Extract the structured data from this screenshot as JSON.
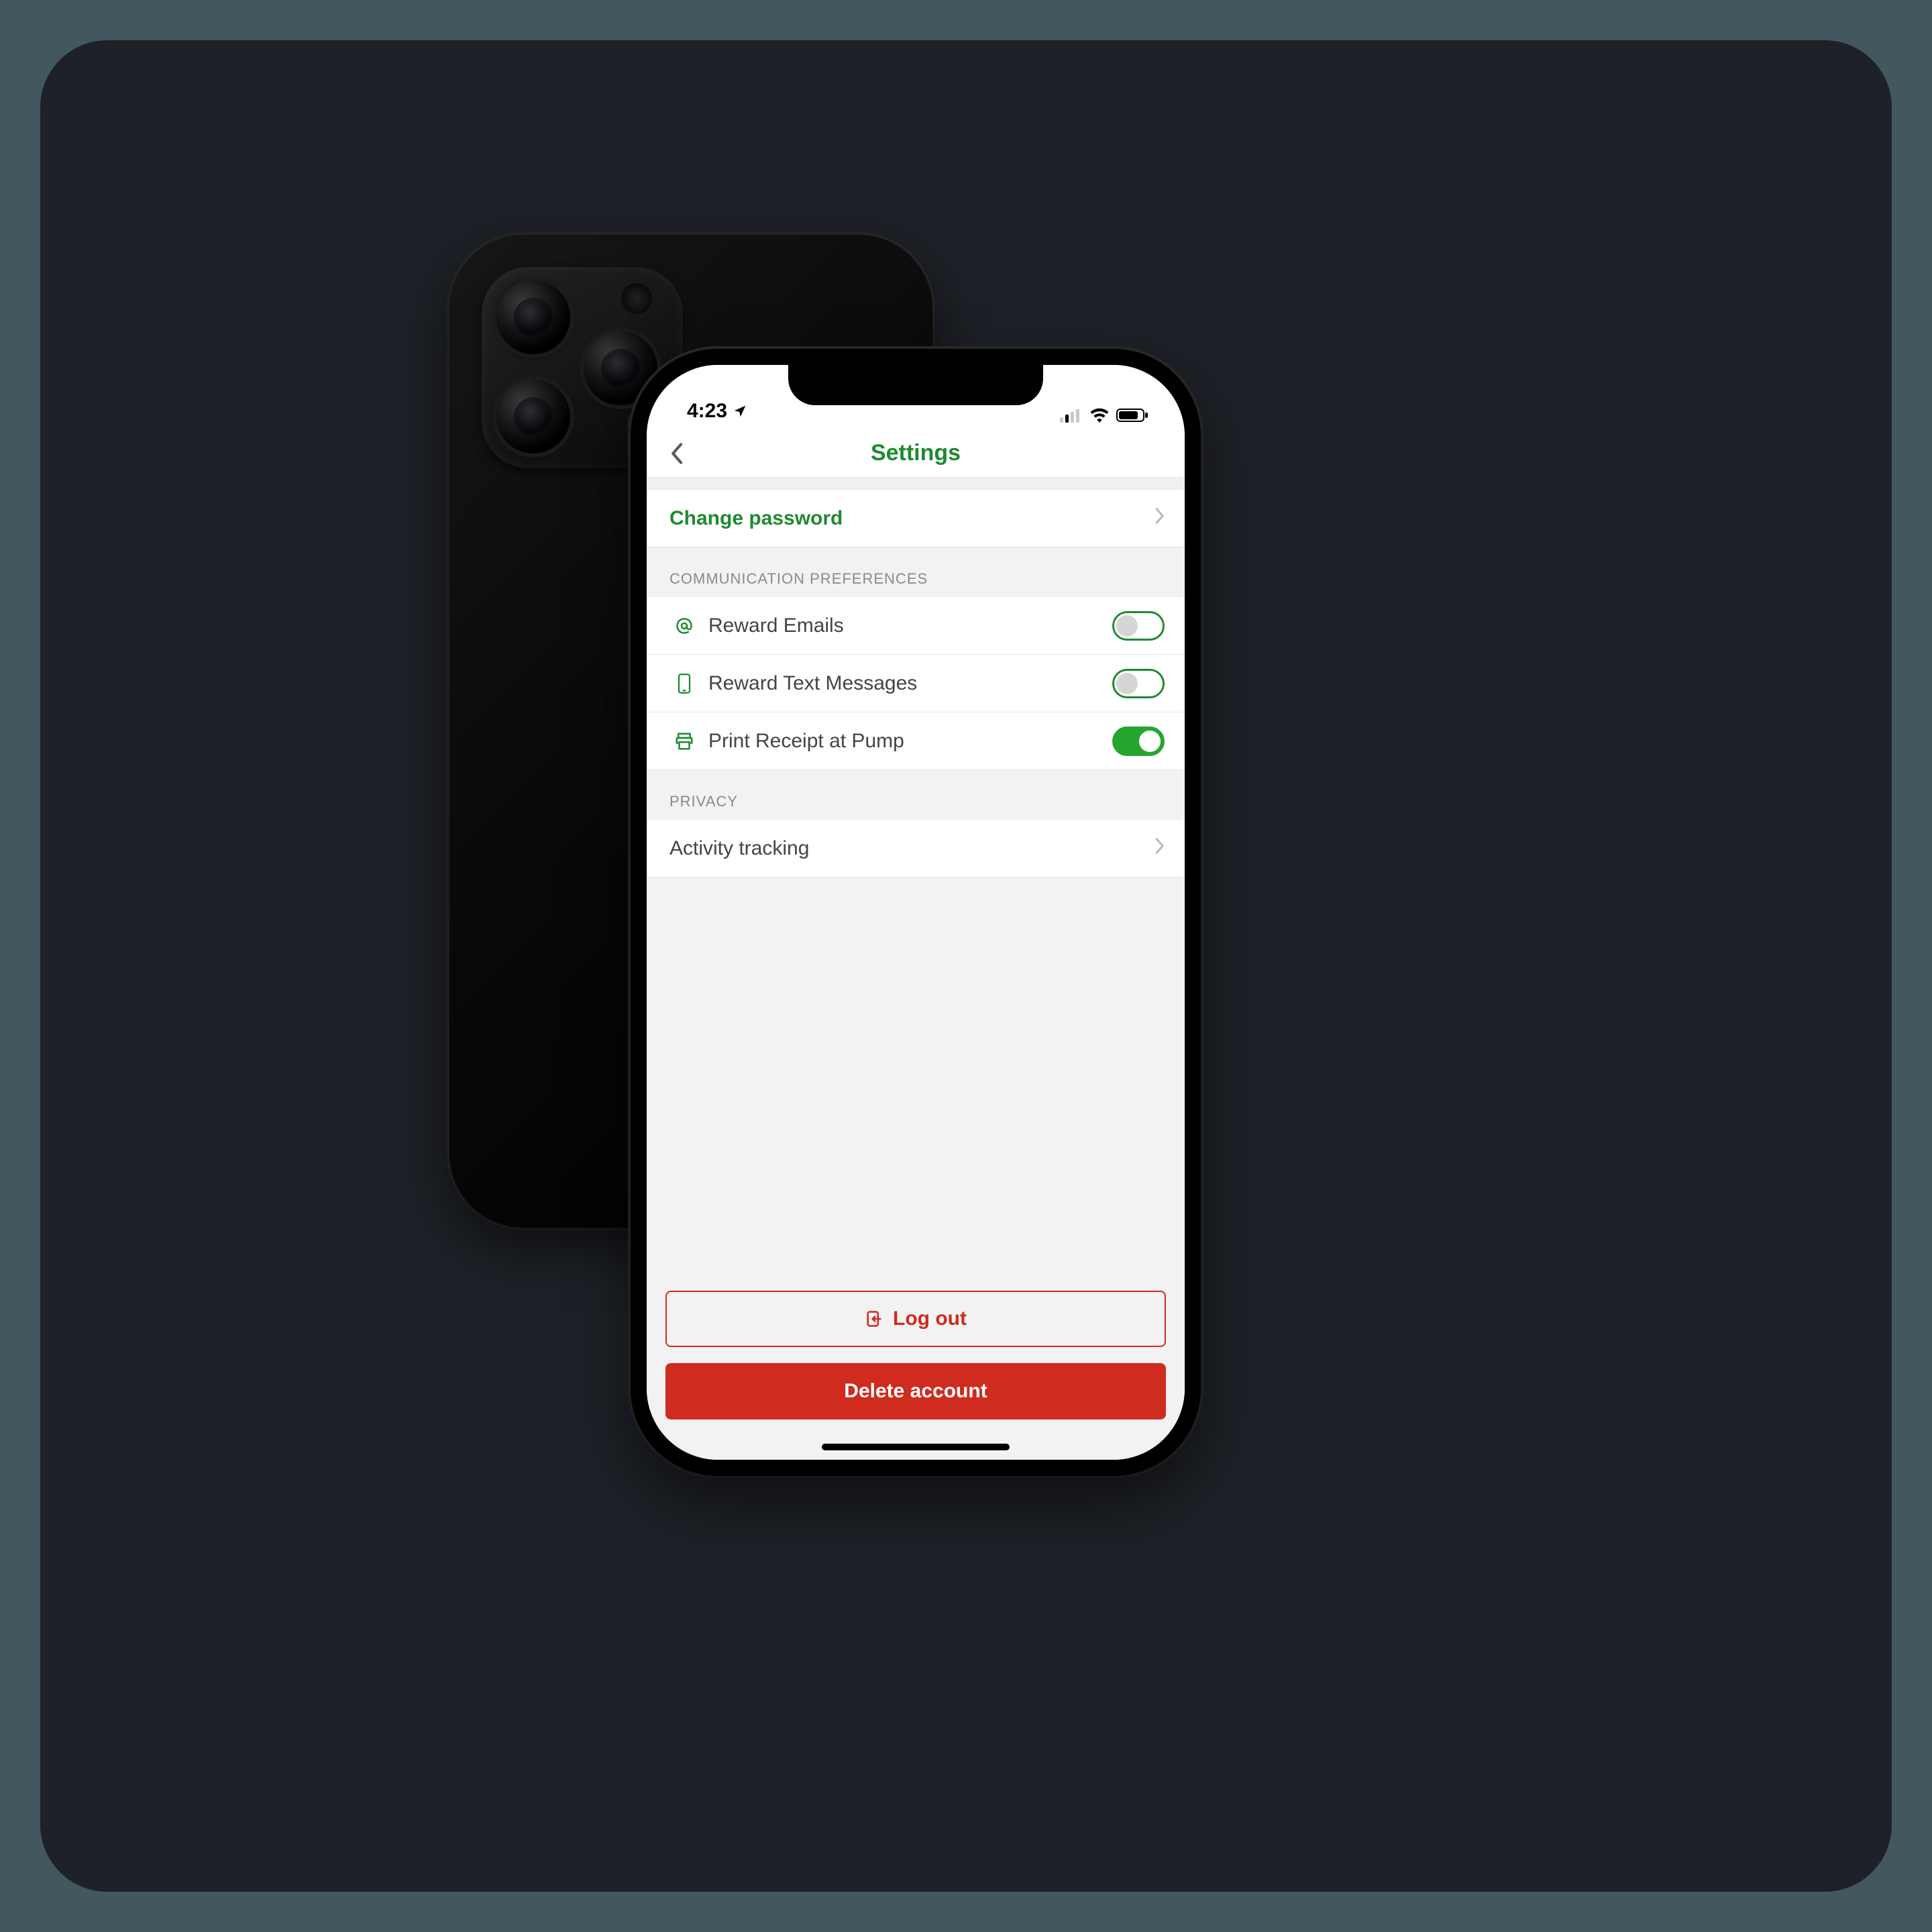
{
  "status": {
    "time": "4:23"
  },
  "nav": {
    "title": "Settings"
  },
  "rows": {
    "change_password": "Change password",
    "activity_tracking": "Activity tracking"
  },
  "sections": {
    "comm": "COMMUNICATION PREFERENCES",
    "privacy": "PRIVACY"
  },
  "prefs": {
    "reward_emails": {
      "label": "Reward Emails",
      "on": false
    },
    "reward_texts": {
      "label": "Reward Text Messages",
      "on": false
    },
    "print_receipt": {
      "label": "Print Receipt at Pump",
      "on": true
    }
  },
  "buttons": {
    "logout": "Log out",
    "delete": "Delete account"
  },
  "colors": {
    "green": "#1f8a32",
    "danger": "#cf2b1f"
  }
}
